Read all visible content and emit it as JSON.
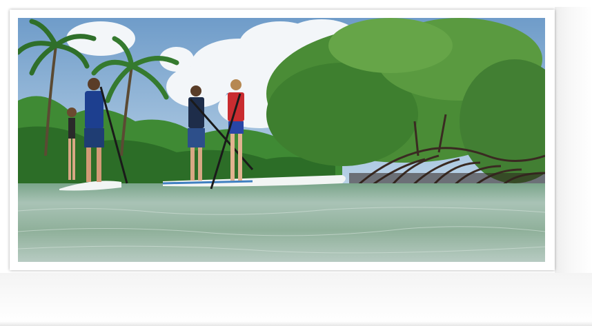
{
  "photo": {
    "subject": "paddleboard-scene",
    "colors": {
      "sky": "#8fb6d8",
      "cloud": "#f4f7fa",
      "water": "#9fb8a4",
      "foliage": "#2f7a2c",
      "mangrove": "#4e8f38",
      "roots": "#3a2a22",
      "board": "#f2f5f4"
    }
  }
}
